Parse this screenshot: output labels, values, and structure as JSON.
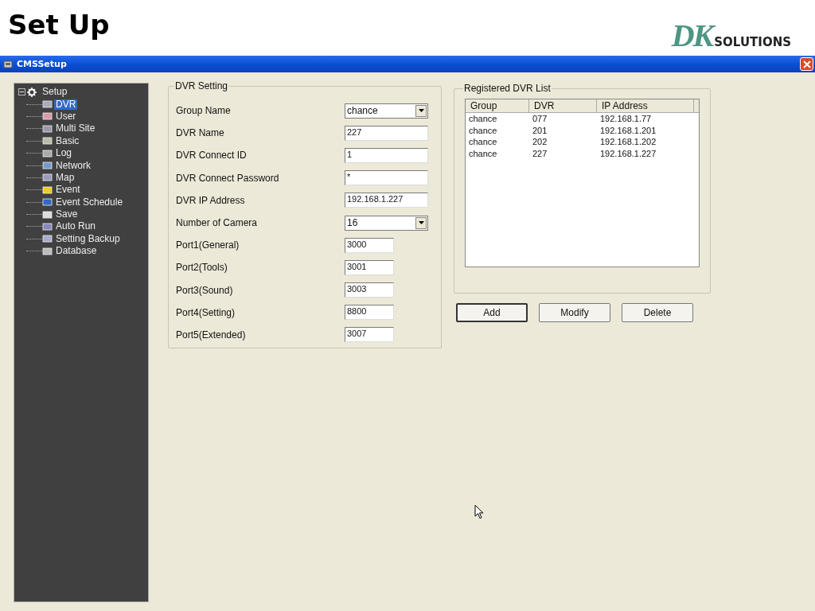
{
  "slide": {
    "title": "Set Up",
    "logo": {
      "mark": "DK",
      "word": "SOLUTIONS"
    }
  },
  "window": {
    "title": "CMSSetup"
  },
  "tree": {
    "label": "Setup",
    "expanded": true,
    "children": [
      {
        "label": "DVR",
        "selected": true
      },
      {
        "label": "User",
        "selected": false
      },
      {
        "label": "Multi Site",
        "selected": false
      },
      {
        "label": "Basic",
        "selected": false
      },
      {
        "label": "Log",
        "selected": false
      },
      {
        "label": "Network",
        "selected": false
      },
      {
        "label": "Map",
        "selected": false
      },
      {
        "label": "Event",
        "selected": false
      },
      {
        "label": "Event Schedule",
        "selected": false
      },
      {
        "label": "Save",
        "selected": false
      },
      {
        "label": "Auto Run",
        "selected": false
      },
      {
        "label": "Setting Backup",
        "selected": false
      },
      {
        "label": "Database",
        "selected": false
      }
    ]
  },
  "dvr_setting": {
    "title": "DVR Setting",
    "fields": [
      {
        "label": "Group Name",
        "kind": "combo",
        "value": "chance"
      },
      {
        "label": "DVR Name",
        "kind": "text",
        "value": "227"
      },
      {
        "label": "DVR Connect ID",
        "kind": "text",
        "value": "1"
      },
      {
        "label": "DVR Connect Password",
        "kind": "text",
        "value": "*"
      },
      {
        "label": "DVR IP Address",
        "kind": "text",
        "value": "192.168.1.227"
      },
      {
        "label": "Number of Camera",
        "kind": "combo",
        "value": "16"
      },
      {
        "label": "Port1(General)",
        "kind": "short",
        "value": "3000"
      },
      {
        "label": "Port2(Tools)",
        "kind": "short",
        "value": "3001"
      },
      {
        "label": "Port3(Sound)",
        "kind": "short",
        "value": "3003"
      },
      {
        "label": "Port4(Setting)",
        "kind": "short",
        "value": "8800"
      },
      {
        "label": "Port5(Extended)",
        "kind": "short",
        "value": "3007"
      }
    ]
  },
  "registered_list": {
    "title": "Registered DVR List",
    "columns": [
      "Group",
      "DVR",
      "IP Address"
    ],
    "rows": [
      [
        "chance",
        "077",
        "192.168.1.77"
      ],
      [
        "chance",
        "201",
        "192.168.1.201"
      ],
      [
        "chance",
        "202",
        "192.168.1.202"
      ],
      [
        "chance",
        "227",
        "192.168.1.227"
      ]
    ]
  },
  "buttons": [
    {
      "label": "Add",
      "selected": true
    },
    {
      "label": "Modify",
      "selected": false
    },
    {
      "label": "Delete",
      "selected": false
    }
  ]
}
